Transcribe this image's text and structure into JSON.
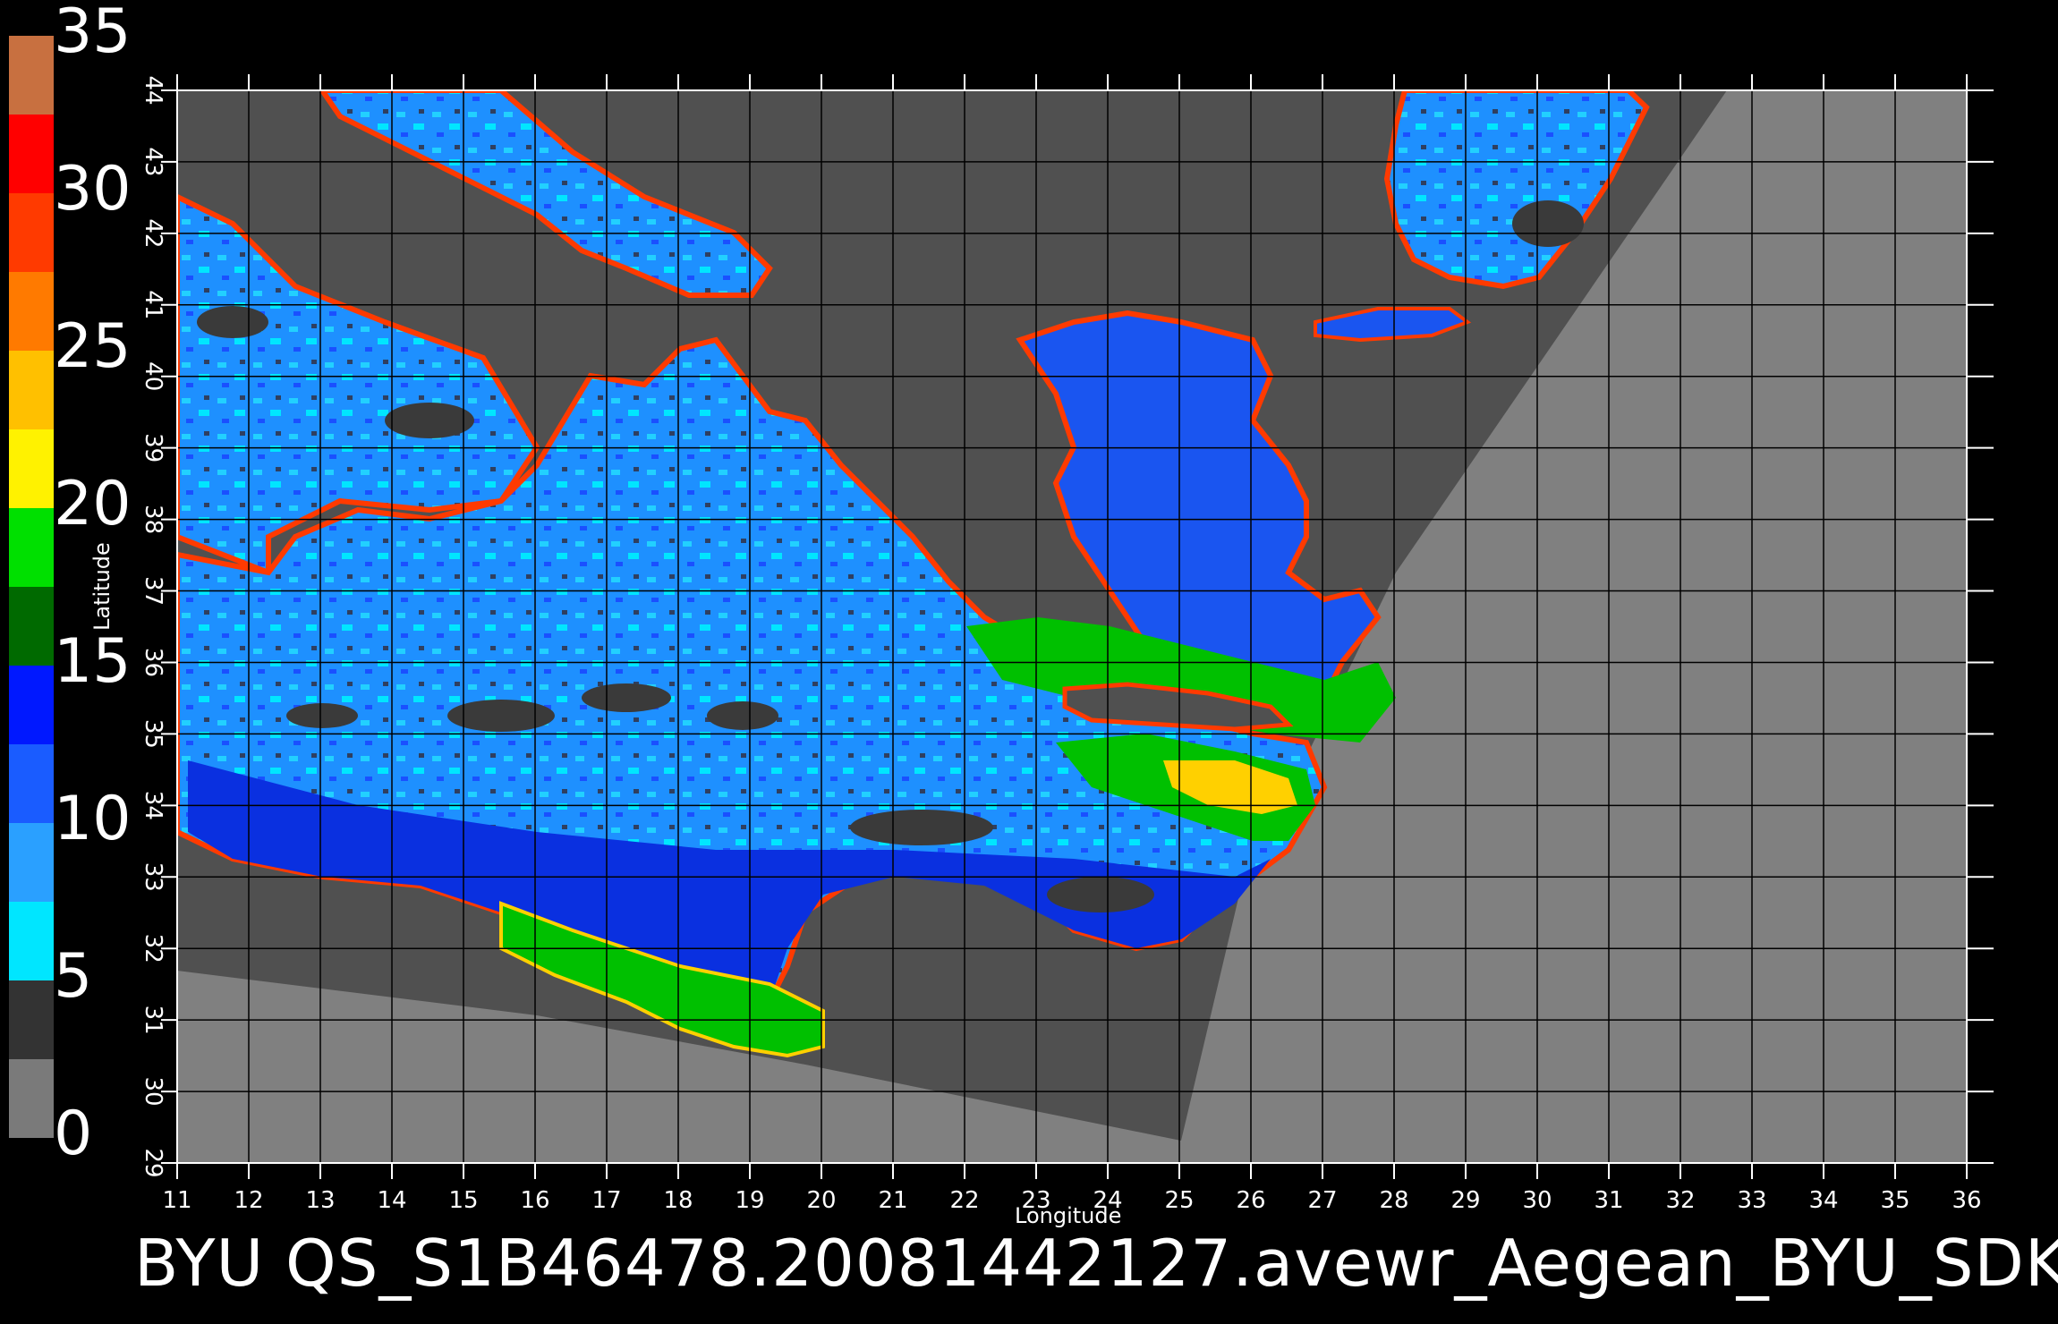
{
  "title": "BYU  QS_S1B46478.20081442127.avewr_Aegean_BYU_SDK",
  "axes": {
    "xlabel": "Longitude",
    "ylabel": "Latitude",
    "x_ticks": [
      "11",
      "12",
      "13",
      "14",
      "15",
      "16",
      "17",
      "18",
      "19",
      "20",
      "21",
      "22",
      "23",
      "24",
      "25",
      "26",
      "27",
      "28",
      "29",
      "30",
      "31",
      "32",
      "33",
      "34",
      "35",
      "36"
    ],
    "y_ticks": [
      "29",
      "30",
      "31",
      "32",
      "33",
      "34",
      "35",
      "36",
      "37",
      "38",
      "39",
      "40",
      "41",
      "42",
      "43",
      "44"
    ],
    "xlim": [
      11,
      36
    ],
    "ylim": [
      29,
      44
    ]
  },
  "colorbar": {
    "labels": [
      "35",
      "30",
      "25",
      "20",
      "15",
      "10",
      "5",
      "0"
    ],
    "min": 0,
    "max": 35,
    "segments": [
      {
        "from": 0,
        "to": 2.5,
        "color": "#7a7a7a"
      },
      {
        "from": 2.5,
        "to": 5,
        "color": "#333333"
      },
      {
        "from": 5,
        "to": 7.5,
        "color": "#00e6ff"
      },
      {
        "from": 7.5,
        "to": 10,
        "color": "#2aa0ff"
      },
      {
        "from": 10,
        "to": 12.5,
        "color": "#1a5cff"
      },
      {
        "from": 12.5,
        "to": 15,
        "color": "#0018ff"
      },
      {
        "from": 15,
        "to": 17.5,
        "color": "#006a00"
      },
      {
        "from": 17.5,
        "to": 20,
        "color": "#00e000"
      },
      {
        "from": 20,
        "to": 22.5,
        "color": "#fff200"
      },
      {
        "from": 22.5,
        "to": 25,
        "color": "#ffc000"
      },
      {
        "from": 25,
        "to": 27.5,
        "color": "#ff7a00"
      },
      {
        "from": 27.5,
        "to": 30,
        "color": "#ff3a00"
      },
      {
        "from": 30,
        "to": 32.5,
        "color": "#ff0000"
      },
      {
        "from": 32.5,
        "to": 35,
        "color": "#c87040"
      }
    ]
  },
  "colors": {
    "background": "#000000",
    "land": "#505050",
    "no_data": "#808080",
    "grid": "#000000"
  }
}
